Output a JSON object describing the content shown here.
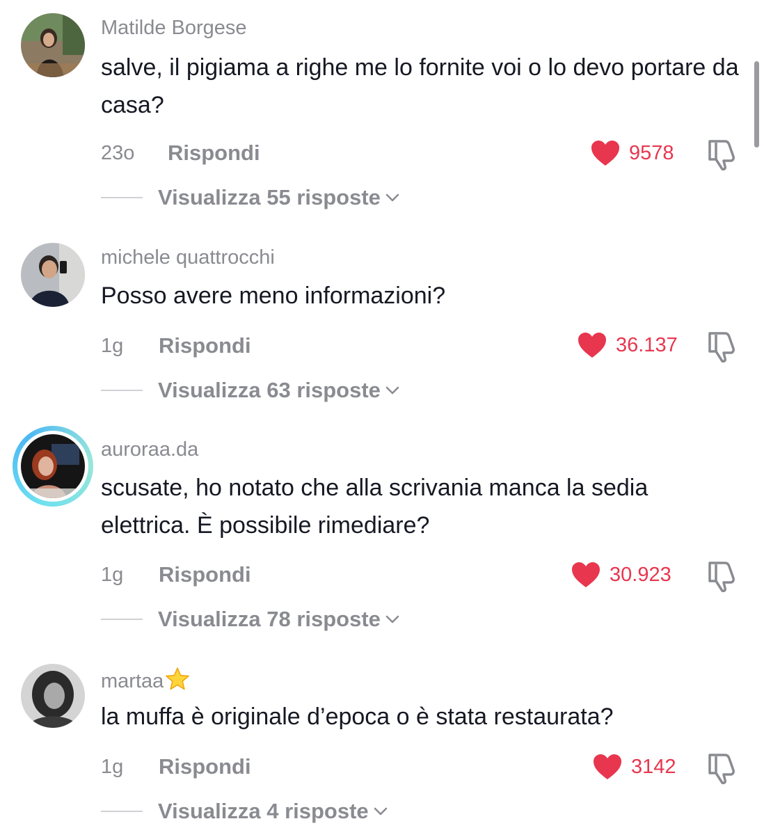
{
  "comments": [
    {
      "username": "Matilde Borgese",
      "text": "salve, il pigiama a righe me lo fornite voi o lo devo portare da casa?",
      "time": "23o",
      "reply_label": "Rispondi",
      "likes": "9578",
      "view_replies": "Visualizza 55 risposte"
    },
    {
      "username": "michele quattrocchi",
      "text": "Posso avere meno informazioni?",
      "time": "1g",
      "reply_label": "Rispondi",
      "likes": "36.137",
      "view_replies": "Visualizza 63 risposte"
    },
    {
      "username": "auroraa.da",
      "text": "scusate, ho notato che alla scrivania manca la sedia elettrica. È possibile rimediare?",
      "time": "1g",
      "reply_label": "Rispondi",
      "likes": "30.923",
      "view_replies": "Visualizza 78 risposte"
    },
    {
      "username": "martaa",
      "username_badge": "star-emoji",
      "text": "la muffa è originale d’epoca o è stata restaurata?",
      "time": "1g",
      "reply_label": "Rispondi",
      "likes": "3142",
      "view_replies": "Visualizza 4 risposte"
    }
  ],
  "colors": {
    "like": "#e8364f",
    "secondary_text": "#8a8b91",
    "primary_text": "#161823",
    "story_ring": "#4cb8f5"
  },
  "icons": {
    "like": "heart-icon",
    "dislike": "thumbs-down-icon",
    "expand": "chevron-down-icon"
  }
}
